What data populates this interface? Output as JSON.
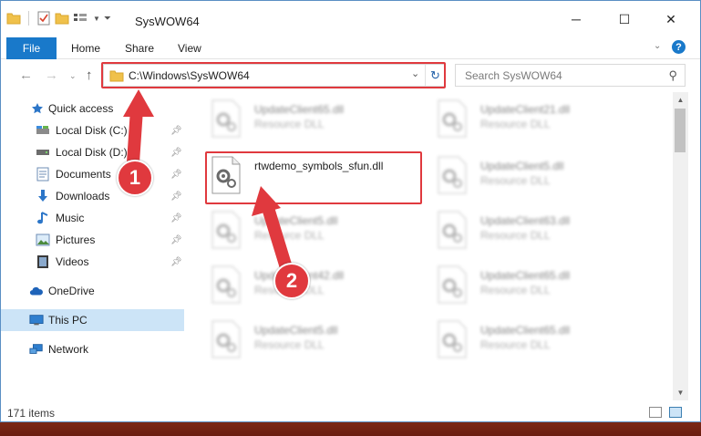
{
  "window": {
    "title": "SysWOW64",
    "controls": {
      "minimize": "─",
      "maximize": "☐",
      "close": "✕"
    }
  },
  "ribbon": {
    "tabs": [
      {
        "label": "File",
        "active": true
      },
      {
        "label": "Home"
      },
      {
        "label": "Share"
      },
      {
        "label": "View"
      }
    ],
    "help": "?"
  },
  "address_bar": {
    "path": "C:\\Windows\\SysWOW64",
    "search_placeholder": "Search SysWOW64"
  },
  "nav_pane": {
    "items": [
      {
        "label": "Quick access",
        "icon": "star-icon",
        "pinned": false
      },
      {
        "label": "Local Disk (C:)",
        "icon": "drive-icon",
        "pinned": true
      },
      {
        "label": "Local Disk (D:)",
        "icon": "drive-icon",
        "pinned": true
      },
      {
        "label": "Documents",
        "icon": "documents-icon",
        "pinned": true
      },
      {
        "label": "Downloads",
        "icon": "downloads-icon",
        "pinned": true
      },
      {
        "label": "Music",
        "icon": "music-icon",
        "pinned": true
      },
      {
        "label": "Pictures",
        "icon": "pictures-icon",
        "pinned": true
      },
      {
        "label": "Videos",
        "icon": "videos-icon",
        "pinned": true
      },
      {
        "label": "OneDrive",
        "icon": "onedrive-icon",
        "pinned": false
      },
      {
        "label": "This PC",
        "icon": "computer-icon",
        "pinned": false,
        "selected": true
      },
      {
        "label": "Network",
        "icon": "network-icon",
        "pinned": false
      }
    ]
  },
  "files": [
    {
      "name": "UpdateClient65.dll",
      "type": "Resource DLL",
      "blurred": true
    },
    {
      "name": "UpdateClient21.dll",
      "type": "Resource DLL",
      "blurred": true
    },
    {
      "name": "rtwdemo_symbols_sfun.dll",
      "type": "",
      "blurred": false,
      "highlighted": true
    },
    {
      "name": "UpdateClient5.dll",
      "type": "Resource DLL",
      "blurred": true
    },
    {
      "name": "UpdateClient5.dll",
      "type": "Resource DLL",
      "blurred": true
    },
    {
      "name": "UpdateClient63.dll",
      "type": "Resource DLL",
      "blurred": true
    },
    {
      "name": "UpdateClient42.dll",
      "type": "Resource DLL",
      "blurred": true
    },
    {
      "name": "UpdateClient65.dll",
      "type": "Resource DLL",
      "blurred": true
    },
    {
      "name": "UpdateClient5.dll",
      "type": "Resource DLL",
      "blurred": true
    },
    {
      "name": "UpdateClient65.dll",
      "type": "Resource DLL",
      "blurred": true
    }
  ],
  "status_bar": {
    "item_count": "171 items"
  },
  "annotations": [
    {
      "number": "1",
      "target": "address bar"
    },
    {
      "number": "2",
      "target": "rtwdemo_symbols_sfun.dll"
    }
  ],
  "colors": {
    "accent": "#1979ca",
    "highlight": "#e0393e",
    "selection": "#cce4f7"
  }
}
